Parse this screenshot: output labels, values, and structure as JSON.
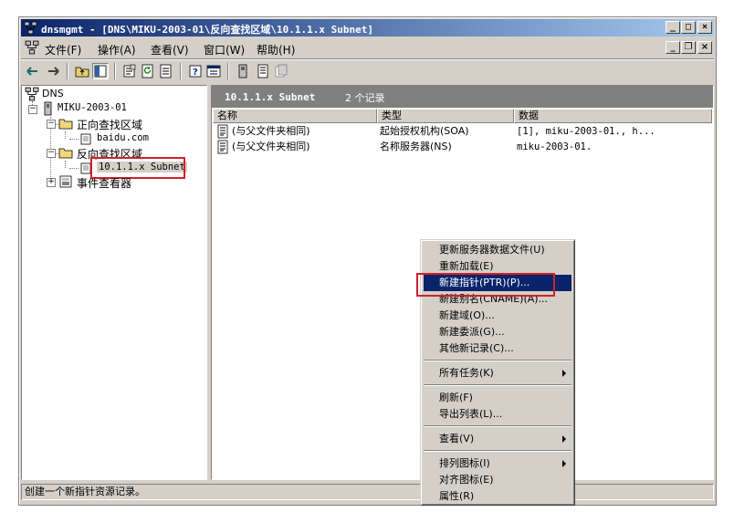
{
  "window": {
    "title": "dnsmgmt - [DNS\\MIKU-2003-01\\反向查找区域\\10.1.1.x Subnet]"
  },
  "menubar": {
    "items": [
      "文件(F)",
      "操作(A)",
      "查看(V)",
      "窗口(W)",
      "帮助(H)"
    ]
  },
  "tree": {
    "root": "DNS",
    "server": "MIKU-2003-01",
    "forward_zones": "正向查找区域",
    "forward_child": "baidu.com",
    "reverse_zones": "反向查找区域",
    "reverse_child": "10.1.1.x Subnet",
    "event_viewer": "事件查看器"
  },
  "details": {
    "title": "10.1.1.x Subnet",
    "count": "2 个记录",
    "columns": [
      "名称",
      "类型",
      "数据"
    ],
    "rows": [
      {
        "name": "(与父文件夹相同)",
        "type": "起始授权机构(SOA)",
        "data": "[1], miku-2003-01., h..."
      },
      {
        "name": "(与父文件夹相同)",
        "type": "名称服务器(NS)",
        "data": "miku-2003-01."
      }
    ]
  },
  "context_menu": {
    "items": [
      {
        "label": "更新服务器数据文件(U)"
      },
      {
        "label": "重新加载(E)"
      },
      {
        "label": "新建指针(PTR)(P)...",
        "selected": true
      },
      {
        "label": "新建别名(CNAME)(A)..."
      },
      {
        "label": "新建域(O)..."
      },
      {
        "label": "新建委派(G)..."
      },
      {
        "label": "其他新记录(C)..."
      },
      {
        "label": "所有任务(K)",
        "submenu": true
      },
      {
        "label": "刷新(F)"
      },
      {
        "label": "导出列表(L)..."
      },
      {
        "label": "查看(V)",
        "submenu": true
      },
      {
        "label": "排列图标(I)",
        "submenu": true
      },
      {
        "label": "对齐图标(E)"
      },
      {
        "label": "属性(R)"
      }
    ]
  },
  "statusbar": {
    "text": "创建一个新指针资源记录。"
  },
  "colors": {
    "title_start": "#0a246a",
    "title_end": "#a6caf0",
    "selection": "#0a246a",
    "highlight_box": "#d0202a",
    "face": "#d4d0c8"
  }
}
